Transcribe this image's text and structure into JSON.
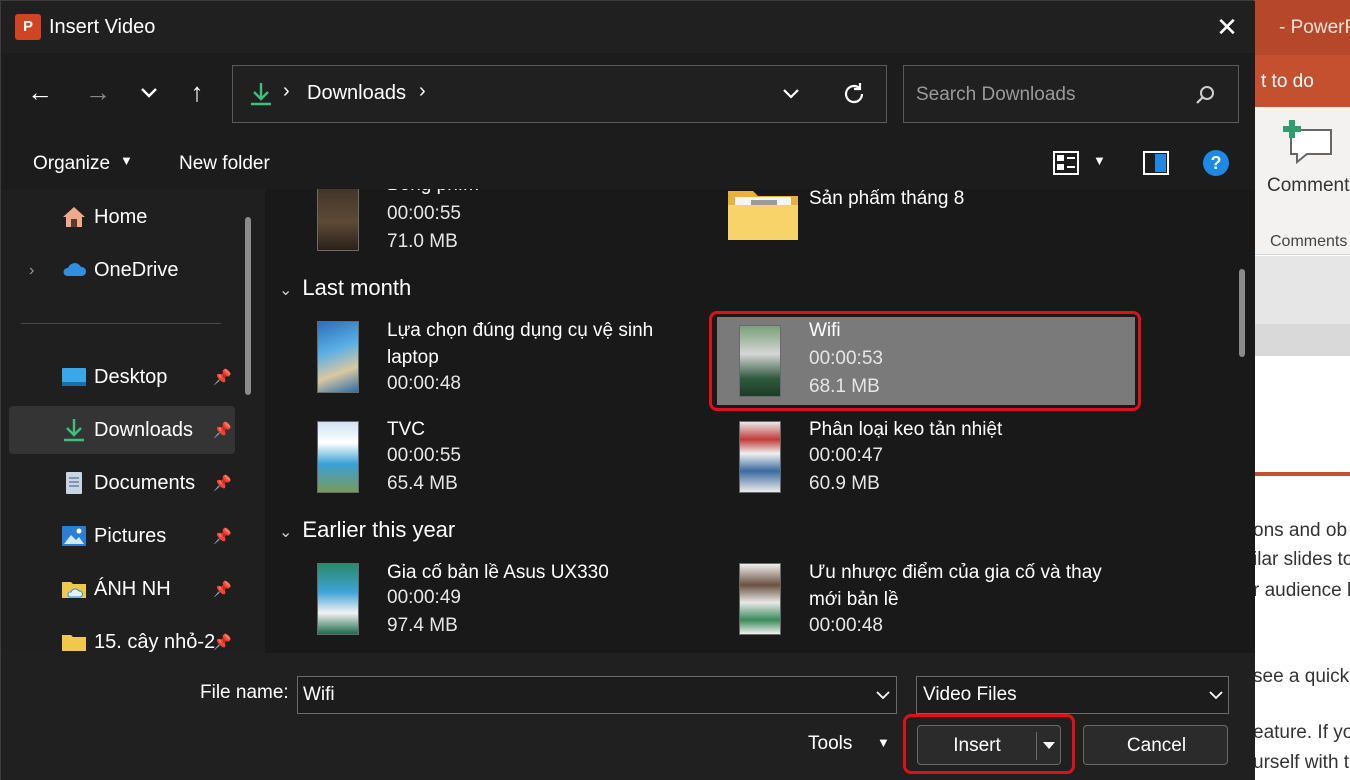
{
  "colors": {
    "highlight": "#e0101a",
    "accent_blue": "#1e88e5",
    "download_green": "#3fbf7f",
    "ppt_orange": "#b7472a"
  },
  "background_app": {
    "title": "- PowerPo",
    "tell_me": "t to do",
    "comment_label": "Comment",
    "group_label": "Comments",
    "text_lines": [
      "ons and ob",
      "ilar slides to",
      "r audience l",
      "see a quick",
      "eature. If yo",
      "urself with t"
    ]
  },
  "dialog": {
    "app_icon_label": "P",
    "title": "Insert Video",
    "close_icon": "close-icon"
  },
  "navigation": {
    "back": "←",
    "forward": "→",
    "recent": "⌄",
    "up": "↑",
    "address_chevron": "›",
    "address_location": "Downloads",
    "search_placeholder": "Search Downloads"
  },
  "toolbar": {
    "organize": "Organize",
    "new_folder": "New folder",
    "help": "?"
  },
  "sidebar": {
    "items": [
      {
        "label": "Home",
        "icon": "home-icon"
      },
      {
        "label": "OneDrive",
        "icon": "cloud-icon"
      },
      {
        "label": "Desktop",
        "icon": "desktop-icon",
        "pinned": true
      },
      {
        "label": "Downloads",
        "icon": "download-icon",
        "pinned": true,
        "selected": true
      },
      {
        "label": "Documents",
        "icon": "document-icon",
        "pinned": true
      },
      {
        "label": "Pictures",
        "icon": "pictures-icon",
        "pinned": true
      },
      {
        "label": "ÁNH NH",
        "icon": "folder-cloud-icon",
        "pinned": true
      },
      {
        "label": "15. cây nhỏ-2",
        "icon": "folder-icon",
        "pinned": true
      }
    ]
  },
  "content": {
    "top_items": [
      {
        "name": "Bóng phím",
        "duration": "00:00:55",
        "size": "71.0 MB"
      },
      {
        "name": "Sản phẩm tháng 8",
        "type": "folder"
      }
    ],
    "groups": [
      {
        "label": "Last month",
        "items": [
          {
            "name_line1": "Lựa chọn đúng dụng cụ vệ sinh",
            "name_line2": "laptop",
            "duration": "00:00:48"
          },
          {
            "name": "Wifi",
            "duration": "00:00:53",
            "size": "68.1 MB",
            "selected": true
          },
          {
            "name": "TVC",
            "duration": "00:00:55",
            "size": "65.4 MB"
          },
          {
            "name": "Phân loại keo tản nhiệt",
            "duration": "00:00:47",
            "size": "60.9 MB"
          }
        ]
      },
      {
        "label": "Earlier this year",
        "items": [
          {
            "name": "Gia cố bản lề Asus UX330",
            "duration": "00:00:49",
            "size": "97.4 MB"
          },
          {
            "name_line1": "Ưu nhược điểm của gia cố và thay",
            "name_line2": "mới bản lề",
            "duration": "00:00:48"
          }
        ]
      }
    ]
  },
  "bottom": {
    "file_name_label": "File name:",
    "file_name_value": "Wifi",
    "file_type": "Video Files",
    "tools": "Tools",
    "insert": "Insert",
    "cancel": "Cancel"
  }
}
